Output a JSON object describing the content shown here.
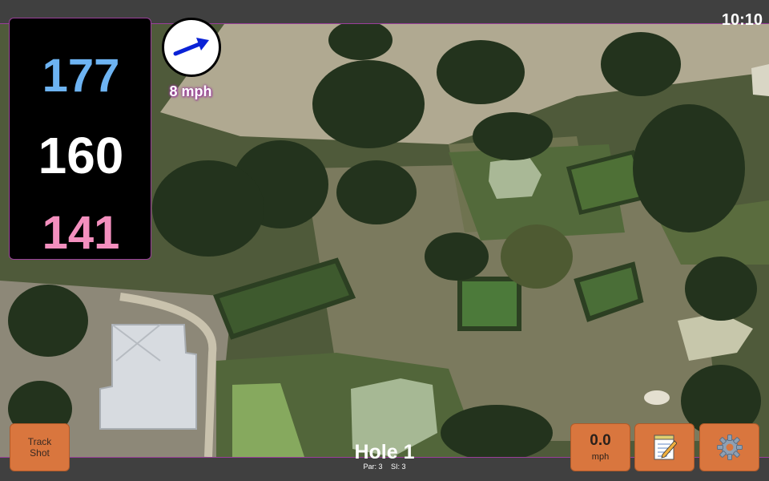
{
  "clock": "10:10",
  "distances": {
    "back": "177",
    "middle": "160",
    "front": "141"
  },
  "wind": {
    "speed_label": "8 mph",
    "direction": "east-northeast"
  },
  "hole": {
    "title": "Hole 1",
    "par_label": "Par: 3",
    "si_label": "SI: 3"
  },
  "buttons": {
    "track_shot_line1": "Track",
    "track_shot_line2": "Shot",
    "shot_speed_value": "0.0",
    "shot_speed_unit": "mph",
    "notes_icon": "notepad-icon",
    "settings_icon": "gear-icon"
  },
  "colors": {
    "back_distance": "#6db3f2",
    "middle_distance": "#ffffff",
    "front_distance": "#f38fbe",
    "accent_border": "#9a3f9a",
    "button": "#d9763e",
    "wind_arrow": "#0a22d6"
  }
}
